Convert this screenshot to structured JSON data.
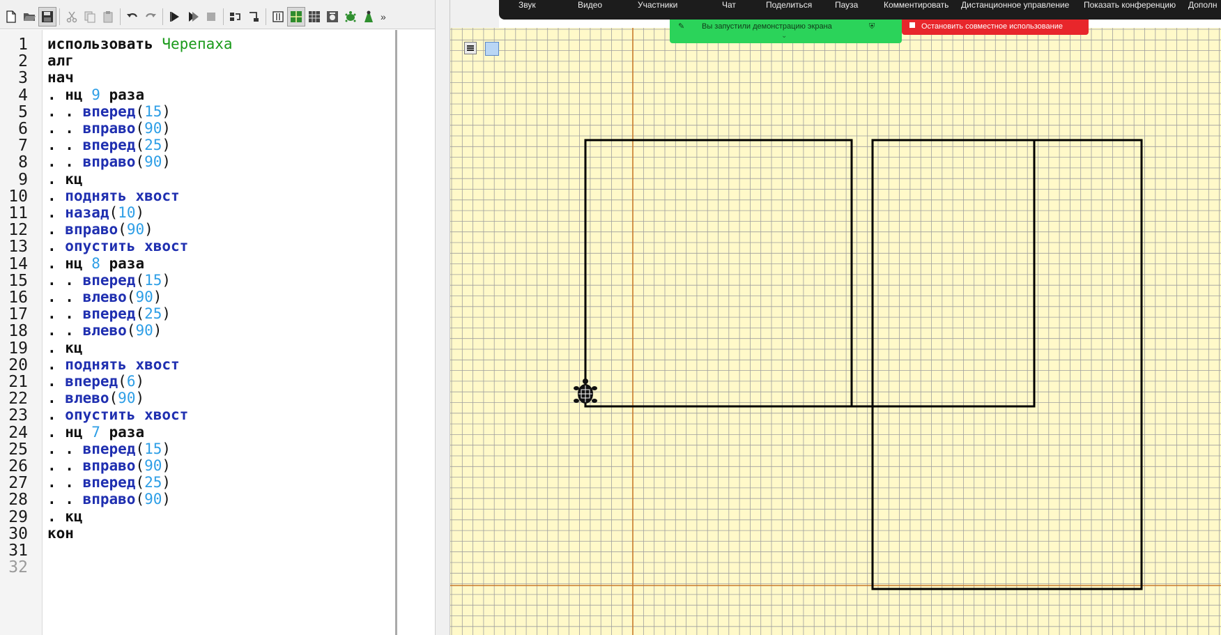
{
  "toolbar": {
    "buttons": [
      "new-file",
      "open-file",
      "save-file",
      "cut",
      "copy",
      "paste",
      "undo",
      "redo",
      "run",
      "step-run",
      "stop",
      "step-over",
      "step-into",
      "fields-panel",
      "table-view",
      "grid-view",
      "turtle-view",
      "robot-view"
    ],
    "more_label": "»"
  },
  "editor": {
    "line_numbers": [
      "1",
      "2",
      "3",
      "4",
      "5",
      "6",
      "7",
      "8",
      "9",
      "10",
      "11",
      "12",
      "13",
      "14",
      "15",
      "16",
      "17",
      "18",
      "19",
      "20",
      "21",
      "22",
      "23",
      "24",
      "25",
      "26",
      "27",
      "28",
      "29",
      "30",
      "31",
      "32"
    ],
    "lines": [
      [
        {
          "t": "использовать ",
          "c": "kw"
        },
        {
          "t": "Черепаха",
          "c": "mod"
        }
      ],
      [
        {
          "t": "алг",
          "c": "kw"
        }
      ],
      [
        {
          "t": "нач",
          "c": "kw"
        }
      ],
      [
        {
          "t": ". нц ",
          "c": "kw"
        },
        {
          "t": "9",
          "c": "num"
        },
        {
          "t": " раза",
          "c": "kw"
        }
      ],
      [
        {
          "t": ". . ",
          "c": "kw"
        },
        {
          "t": "вперед",
          "c": "cmd"
        },
        {
          "t": "(",
          "c": "par"
        },
        {
          "t": "15",
          "c": "num"
        },
        {
          "t": ")",
          "c": "par"
        }
      ],
      [
        {
          "t": ". . ",
          "c": "kw"
        },
        {
          "t": "вправо",
          "c": "cmd"
        },
        {
          "t": "(",
          "c": "par"
        },
        {
          "t": "90",
          "c": "num"
        },
        {
          "t": ")",
          "c": "par"
        }
      ],
      [
        {
          "t": ". . ",
          "c": "kw"
        },
        {
          "t": "вперед",
          "c": "cmd"
        },
        {
          "t": "(",
          "c": "par"
        },
        {
          "t": "25",
          "c": "num"
        },
        {
          "t": ")",
          "c": "par"
        }
      ],
      [
        {
          "t": ". . ",
          "c": "kw"
        },
        {
          "t": "вправо",
          "c": "cmd"
        },
        {
          "t": "(",
          "c": "par"
        },
        {
          "t": "90",
          "c": "num"
        },
        {
          "t": ")",
          "c": "par"
        }
      ],
      [
        {
          "t": ". кц",
          "c": "kw"
        }
      ],
      [
        {
          "t": ". ",
          "c": "kw"
        },
        {
          "t": "поднять хвост",
          "c": "cmd"
        }
      ],
      [
        {
          "t": ". ",
          "c": "kw"
        },
        {
          "t": "назад",
          "c": "cmd"
        },
        {
          "t": "(",
          "c": "par"
        },
        {
          "t": "10",
          "c": "num"
        },
        {
          "t": ")",
          "c": "par"
        }
      ],
      [
        {
          "t": ". ",
          "c": "kw"
        },
        {
          "t": "вправо",
          "c": "cmd"
        },
        {
          "t": "(",
          "c": "par"
        },
        {
          "t": "90",
          "c": "num"
        },
        {
          "t": ")",
          "c": "par"
        }
      ],
      [
        {
          "t": ". ",
          "c": "kw"
        },
        {
          "t": "опустить хвост",
          "c": "cmd"
        }
      ],
      [
        {
          "t": ". нц ",
          "c": "kw"
        },
        {
          "t": "8",
          "c": "num"
        },
        {
          "t": " раза",
          "c": "kw"
        }
      ],
      [
        {
          "t": ". . ",
          "c": "kw"
        },
        {
          "t": "вперед",
          "c": "cmd"
        },
        {
          "t": "(",
          "c": "par"
        },
        {
          "t": "15",
          "c": "num"
        },
        {
          "t": ")",
          "c": "par"
        }
      ],
      [
        {
          "t": ". . ",
          "c": "kw"
        },
        {
          "t": "влево",
          "c": "cmd"
        },
        {
          "t": "(",
          "c": "par"
        },
        {
          "t": "90",
          "c": "num"
        },
        {
          "t": ")",
          "c": "par"
        }
      ],
      [
        {
          "t": ". . ",
          "c": "kw"
        },
        {
          "t": "вперед",
          "c": "cmd"
        },
        {
          "t": "(",
          "c": "par"
        },
        {
          "t": "25",
          "c": "num"
        },
        {
          "t": ")",
          "c": "par"
        }
      ],
      [
        {
          "t": ". . ",
          "c": "kw"
        },
        {
          "t": "влево",
          "c": "cmd"
        },
        {
          "t": "(",
          "c": "par"
        },
        {
          "t": "90",
          "c": "num"
        },
        {
          "t": ")",
          "c": "par"
        }
      ],
      [
        {
          "t": ". кц",
          "c": "kw"
        }
      ],
      [
        {
          "t": ". ",
          "c": "kw"
        },
        {
          "t": "поднять хвост",
          "c": "cmd"
        }
      ],
      [
        {
          "t": ". ",
          "c": "kw"
        },
        {
          "t": "вперед",
          "c": "cmd"
        },
        {
          "t": "(",
          "c": "par"
        },
        {
          "t": "6",
          "c": "num"
        },
        {
          "t": ")",
          "c": "par"
        }
      ],
      [
        {
          "t": ". ",
          "c": "kw"
        },
        {
          "t": "влево",
          "c": "cmd"
        },
        {
          "t": "(",
          "c": "par"
        },
        {
          "t": "90",
          "c": "num"
        },
        {
          "t": ")",
          "c": "par"
        }
      ],
      [
        {
          "t": ". ",
          "c": "kw"
        },
        {
          "t": "опустить хвост",
          "c": "cmd"
        }
      ],
      [
        {
          "t": ". нц ",
          "c": "kw"
        },
        {
          "t": "7",
          "c": "num"
        },
        {
          "t": " раза",
          "c": "kw"
        }
      ],
      [
        {
          "t": ". . ",
          "c": "kw"
        },
        {
          "t": "вперед",
          "c": "cmd"
        },
        {
          "t": "(",
          "c": "par"
        },
        {
          "t": "15",
          "c": "num"
        },
        {
          "t": ")",
          "c": "par"
        }
      ],
      [
        {
          "t": ". . ",
          "c": "kw"
        },
        {
          "t": "вправо",
          "c": "cmd"
        },
        {
          "t": "(",
          "c": "par"
        },
        {
          "t": "90",
          "c": "num"
        },
        {
          "t": ")",
          "c": "par"
        }
      ],
      [
        {
          "t": ". . ",
          "c": "kw"
        },
        {
          "t": "вперед",
          "c": "cmd"
        },
        {
          "t": "(",
          "c": "par"
        },
        {
          "t": "25",
          "c": "num"
        },
        {
          "t": ")",
          "c": "par"
        }
      ],
      [
        {
          "t": ". . ",
          "c": "kw"
        },
        {
          "t": "вправо",
          "c": "cmd"
        },
        {
          "t": "(",
          "c": "par"
        },
        {
          "t": "90",
          "c": "num"
        },
        {
          "t": ")",
          "c": "par"
        }
      ],
      [
        {
          "t": ". кц",
          "c": "kw"
        }
      ],
      [
        {
          "t": "кон",
          "c": "kw"
        }
      ],
      [],
      []
    ]
  },
  "conference": {
    "items": [
      "Звук",
      "Видео",
      "Участники",
      "Чат",
      "Поделиться",
      "Пауза",
      "Комментировать",
      "Дистанционное управление",
      "Показать конференцию",
      "Дополн"
    ],
    "sharing_status": "Вы запустили демонстрацию экрана",
    "stop_sharing": "Остановить совместное использование"
  },
  "canvas": {
    "drawing": {
      "cell_units": 1,
      "shape_a": {
        "width": 25,
        "height": 15,
        "description_units": "turtle steps"
      },
      "shape_b": {
        "width": 15,
        "height": 25
      }
    },
    "colors": {
      "background": "#fff9c9",
      "grid": "#9e9e9e",
      "axis": "#c87a2a",
      "stroke": "#000000"
    }
  }
}
